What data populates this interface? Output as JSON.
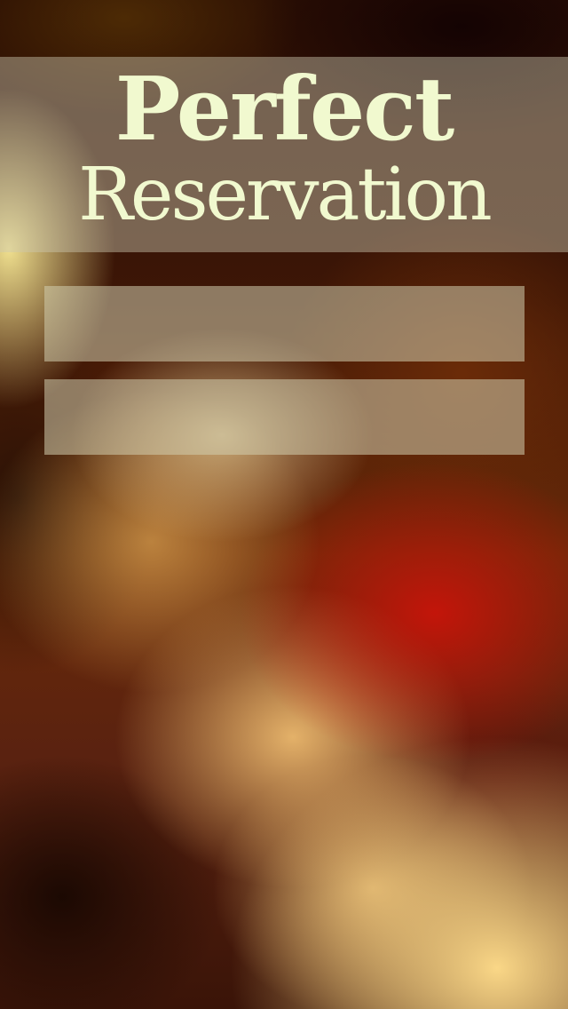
{
  "app": {
    "title_line1": "Perfect",
    "title_line2": "Reservation"
  },
  "form": {
    "field1": {
      "value": "",
      "placeholder": ""
    },
    "field2": {
      "value": "",
      "placeholder": ""
    }
  },
  "colors": {
    "title_text": "#f1f9cf",
    "banner": "rgba(205,200,175,0.45)",
    "field_fill": "rgba(210,205,175,0.55)"
  }
}
